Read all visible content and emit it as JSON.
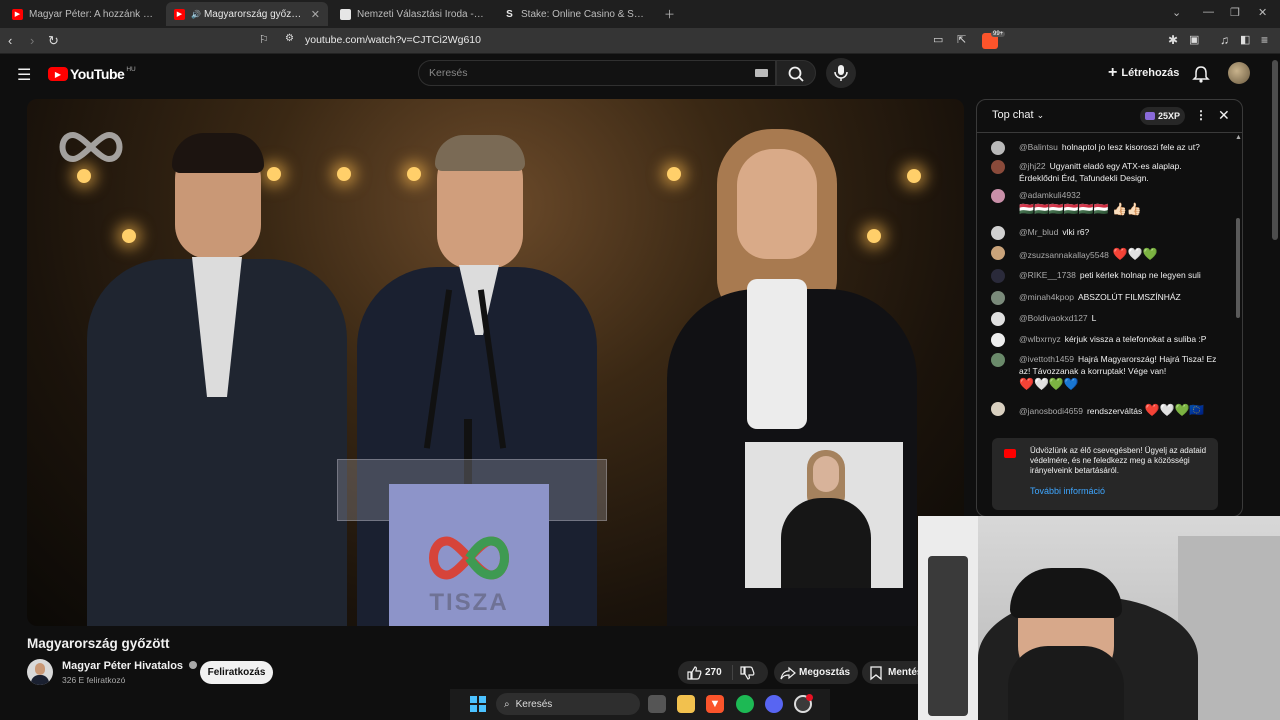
{
  "browser": {
    "tabs": [
      {
        "title": "Magyar Péter: A hozzánk beérkező a",
        "favicon": "youtube-icon",
        "active": false
      },
      {
        "title": "Magyarország győzött - YouT",
        "favicon": "youtube-icon",
        "active": true
      },
      {
        "title": "Nemzeti Választási Iroda - Országgy",
        "favicon": "nvi-icon",
        "active": false
      },
      {
        "title": "Stake: Online Casino & Sports Betting",
        "favicon": "stake-icon",
        "active": false
      }
    ],
    "url": "youtube.com/watch?v=CJTCi2Wg610",
    "brave_badge": "99+"
  },
  "youtube": {
    "logo_text": "YouTube",
    "country": "HU",
    "search_placeholder": "Keresés",
    "create_label": "Létrehozás"
  },
  "video": {
    "title": "Magyarország győzött",
    "lectern_text": "TISZA",
    "channel_name": "Magyar Péter Hivatalos",
    "subscribers": "326 E feliratkozó",
    "subscribe_label": "Feliratkozás",
    "likes": "270",
    "share_label": "Megosztás",
    "save_label": "Mentés"
  },
  "chat": {
    "mode": "Top chat",
    "xp_badge": "25XP",
    "messages": [
      {
        "author": "@Balintsu",
        "text": "holnaptol jo lesz kisoroszi fele az ut?",
        "avatar_color": "#b9b9b9"
      },
      {
        "author": "@jhj22",
        "text": "Ugyanitt eladó egy ATX-es alaplap. Érdeklődni Érd, Tafundekli Design.",
        "avatar_color": "#8a4a3a"
      },
      {
        "author": "@adamkuli4932",
        "text": "",
        "emojis": "🇭🇺🇭🇺🇭🇺🇭🇺🇭🇺🇭🇺 👍🏻👍🏻",
        "avatar_color": "#c98fa8"
      },
      {
        "author": "@Mr_blud",
        "text": "vlki r6?",
        "avatar_color": "#d0d0d0"
      },
      {
        "author": "@zsuzsannakallay5548",
        "text": "",
        "emojis": "❤️🤍💚",
        "avatar_color": "#c9a37a"
      },
      {
        "author": "@RIKE__1738",
        "text": "peti kérlek holnap ne legyen suli",
        "avatar_color": "#2a2a3a"
      },
      {
        "author": "@minah4kpop",
        "text": "ABSZOLÚT FILMSZÍNHÁZ",
        "avatar_color": "#7a8a7a"
      },
      {
        "author": "@Boldivaokxd127",
        "text": "L",
        "avatar_color": "#e0e0e0"
      },
      {
        "author": "@wlbxrnyz",
        "text": "kérjuk vissza a telefonokat a suliba :P",
        "avatar_color": "#eeeeee"
      },
      {
        "author": "@ivettoth1459",
        "text": "Hajrá Magyarország! Hajrá Tisza! Ez az! Távozzanak a korruptak! Vége van!",
        "emojis": "❤️🤍💚💙",
        "avatar_color": "#6a8a6a"
      },
      {
        "author": "@janosbodi4659",
        "text": "rendszerváltás",
        "emojis": "❤️🤍💚🇪🇺",
        "avatar_color": "#d9d0c0"
      }
    ],
    "notice_text": "Üdvözlünk az élő csevegésben! Ügyelj az adataid védelmére, és ne feledkezz meg a közösségi irányelveink betartásáról.",
    "notice_link": "További információ"
  },
  "taskbar": {
    "search_label": "Keresés"
  },
  "colors": {
    "youtube_red": "#ff0000",
    "background": "#0f0f0f",
    "link_blue": "#3ea6ff"
  }
}
